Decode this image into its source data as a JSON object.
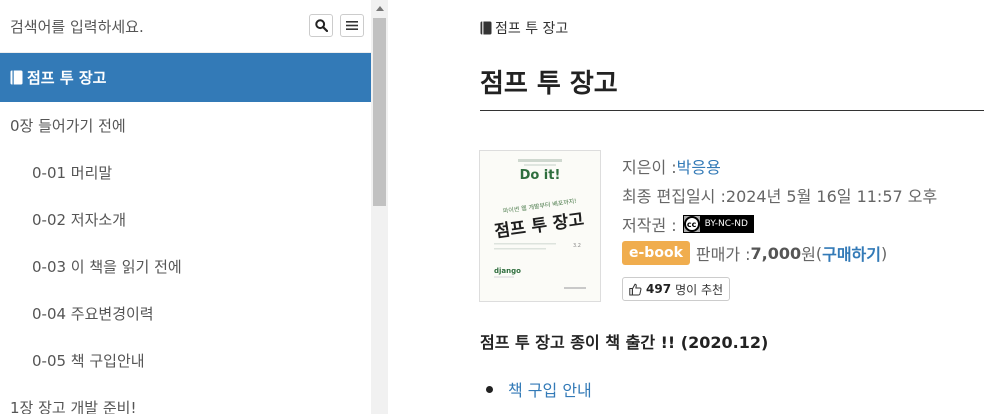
{
  "search": {
    "placeholder": "검색어를 입력하세요."
  },
  "sidebar": {
    "active": {
      "label": "점프 투 장고"
    },
    "items": [
      {
        "label": "0장 들어가기 전에"
      },
      {
        "label": "0-01 머리말"
      },
      {
        "label": "0-02 저자소개"
      },
      {
        "label": "0-03 이 책을 읽기 전에"
      },
      {
        "label": "0-04 주요변경이력"
      },
      {
        "label": "0-05 책 구입안내"
      },
      {
        "label": "1장 장고 개발 준비!"
      }
    ]
  },
  "main": {
    "breadcrumb": "점프 투 장고",
    "title": "점프 투 장고",
    "cover": {
      "small_top": "파이썬 웹 개발부터 배포까지!",
      "doit": "Do it!",
      "subtitle": "파이썬 웹 개발부터 배포까지!",
      "title": "점프 투 장고",
      "edition": "3.2",
      "logo": "django"
    },
    "meta": {
      "author_label": "지은이 : ",
      "author": "박응용",
      "updated_label": "최종 편집일시 : ",
      "updated": "2024년 5월 16일 11:57 오후",
      "license_label": "저작권 : ",
      "license_badge": "BY-NC-ND",
      "ebook": "e-book",
      "price_label": "판매가 : ",
      "price": "7,000",
      "currency": "원",
      "paren_open": " (",
      "buy": "구매하기",
      "paren_close": ")"
    },
    "recommend": {
      "count": "497",
      "suffix": "명이 추천"
    },
    "notice": "점프 투 장고 종이 책 출간 !! (2020.12)",
    "buy_guide": "책 구입 안내"
  },
  "colors": {
    "accent": "#337ab7",
    "ebook": "#f0ad4e"
  }
}
